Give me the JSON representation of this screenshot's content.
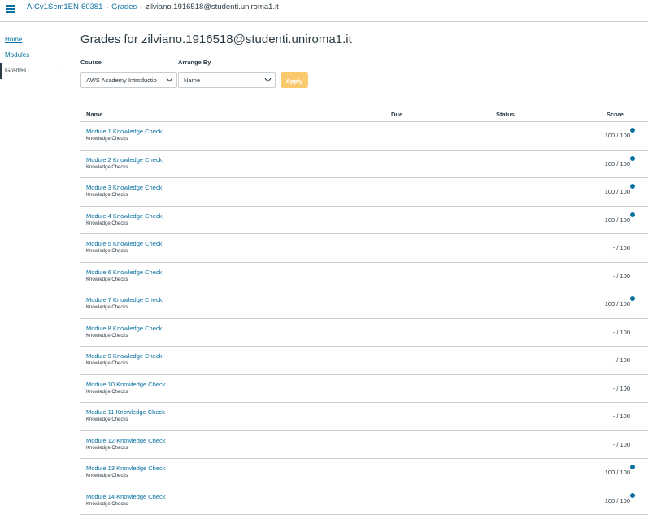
{
  "breadcrumb": {
    "course": "AICv1Sem1EN-60381",
    "section": "Grades",
    "current": "zilviano.1916518@studenti.uniroma1.it"
  },
  "nav": {
    "home": "Home",
    "modules": "Modules",
    "grades": "Grades",
    "grades_icon": "eye-off-icon"
  },
  "page": {
    "title": "Grades for zilviano.1916518@studenti.uniroma1.it"
  },
  "filters": {
    "course_label": "Course",
    "course_value": "AWS Academy Introductio",
    "arrange_label": "Arrange By",
    "arrange_value": "Name",
    "apply_label": "Apply"
  },
  "table": {
    "headers": {
      "name": "Name",
      "due": "Due",
      "status": "Status",
      "score": "Score"
    },
    "rows": [
      {
        "name": "Module 1 Knowledge Check",
        "category": "Knowledge Checks",
        "score": "100 / 100",
        "unread": true
      },
      {
        "name": "Module 2 Knowledge Check",
        "category": "Knowledge Checks",
        "score": "100 / 100",
        "unread": true
      },
      {
        "name": "Module 3 Knowledge Check",
        "category": "Knowledge Checks",
        "score": "100 / 100",
        "unread": true
      },
      {
        "name": "Module 4 Knowledge Check",
        "category": "Knowledge Checks",
        "score": "100 / 100",
        "unread": true
      },
      {
        "name": "Module 5 Knowledge Check",
        "category": "Knowledge Checks",
        "score": "- / 100",
        "unread": false
      },
      {
        "name": "Module 6 Knowledge Check",
        "category": "Knowledge Checks",
        "score": "- / 100",
        "unread": false
      },
      {
        "name": "Module 7 Knowledge Check",
        "category": "Knowledge Checks",
        "score": "100 / 100",
        "unread": true
      },
      {
        "name": "Module 8 Knowledge Check",
        "category": "Knowledge Checks",
        "score": "- / 100",
        "unread": false
      },
      {
        "name": "Module 9 Knowledge Check",
        "category": "Knowledge Checks",
        "score": "- / 100",
        "unread": false
      },
      {
        "name": "Module 10 Knowledge Check",
        "category": "Knowledge Checks",
        "score": "- / 100",
        "unread": false
      },
      {
        "name": "Module 11 Knowledge Check",
        "category": "Knowledge Checks",
        "score": "- / 100",
        "unread": false
      },
      {
        "name": "Module 12 Knowledge Check",
        "category": "Knowledge Checks",
        "score": "- / 100",
        "unread": false
      },
      {
        "name": "Module 13 Knowledge Check",
        "category": "Knowledge Checks",
        "score": "100 / 100",
        "unread": true
      },
      {
        "name": "Module 14 Knowledge Check",
        "category": "Knowledge Checks",
        "score": "100 / 100",
        "unread": true
      }
    ]
  },
  "colors": {
    "link": "#0770a3",
    "text": "#2d3b45",
    "border": "#c7cdd1",
    "apply_button": "#fac96e",
    "nav_warning": "#f0a020"
  }
}
